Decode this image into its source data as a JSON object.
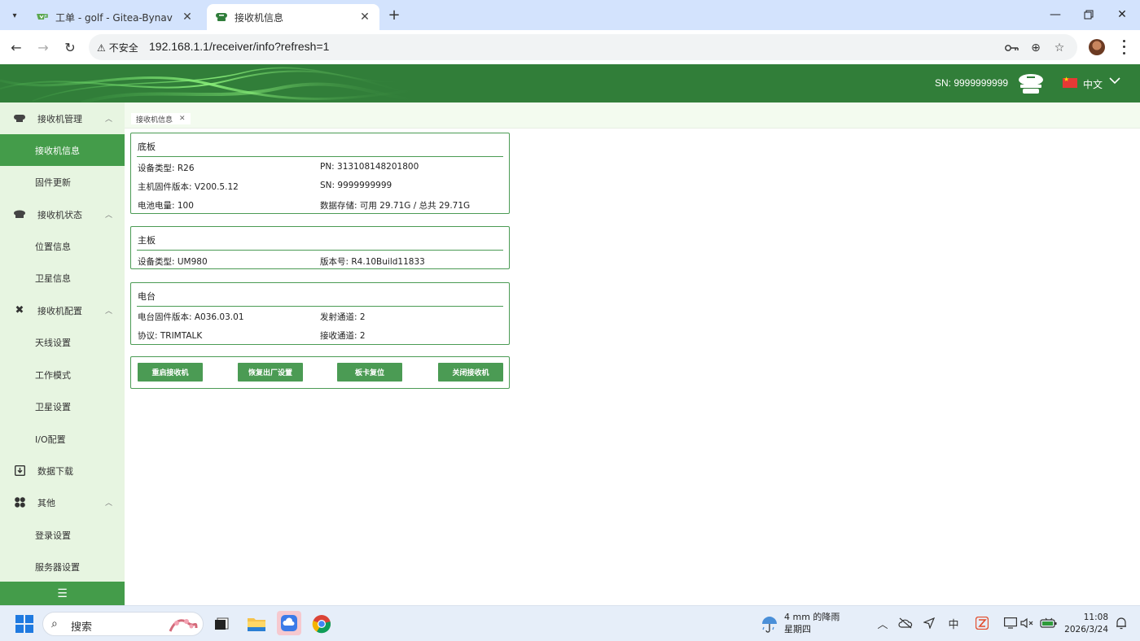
{
  "browser": {
    "tabs": [
      {
        "title": "工单 - golf - Gitea-Bynav",
        "active": false
      },
      {
        "title": "接收机信息",
        "active": true
      }
    ],
    "security_label": "不安全",
    "url": "192.168.1.1/receiver/info?refresh=1"
  },
  "header": {
    "sn": "SN: 9999999999",
    "language": "中文",
    "flag": "CN"
  },
  "sidebar": {
    "items": [
      {
        "label": "接收机管理",
        "type": "group",
        "icon": "receiver-manage-icon",
        "expanded": true
      },
      {
        "label": "接收机信息",
        "type": "sub",
        "active": true
      },
      {
        "label": "固件更新",
        "type": "sub"
      },
      {
        "label": "接收机状态",
        "type": "group",
        "icon": "receiver-status-icon",
        "expanded": true
      },
      {
        "label": "位置信息",
        "type": "sub"
      },
      {
        "label": "卫星信息",
        "type": "sub"
      },
      {
        "label": "接收机配置",
        "type": "group",
        "icon": "tools-icon",
        "expanded": true
      },
      {
        "label": "天线设置",
        "type": "sub"
      },
      {
        "label": "工作模式",
        "type": "sub"
      },
      {
        "label": "卫星设置",
        "type": "sub"
      },
      {
        "label": "I/O配置",
        "type": "sub"
      },
      {
        "label": "数据下载",
        "type": "group",
        "icon": "download-icon"
      },
      {
        "label": "其他",
        "type": "group",
        "icon": "grid-icon",
        "expanded": true
      },
      {
        "label": "登录设置",
        "type": "sub"
      },
      {
        "label": "服务器设置",
        "type": "sub"
      }
    ]
  },
  "page_tab": {
    "label": "接收机信息"
  },
  "baseboard": {
    "title": "底板",
    "device_type": "设备类型: R26",
    "pn": "PN: 313108148201800",
    "firmware": "主机固件版本: V200.5.12",
    "sn": "SN: 9999999999",
    "battery": "电池电量: 100",
    "storage": "数据存储: 可用 29.71G / 总共 29.71G"
  },
  "mainboard": {
    "title": "主板",
    "device_type": "设备类型: UM980",
    "version": "版本号: R4.10Build11833"
  },
  "radio": {
    "title": "电台",
    "firmware": "电台固件版本: A036.03.01",
    "tx_channel": "发射通道: 2",
    "protocol": "协议: TRIMTALK",
    "rx_channel": "接收通道: 2"
  },
  "actions": {
    "restart": "重启接收机",
    "factory_reset": "恢复出厂设置",
    "board_reset": "板卡复位",
    "shutdown": "关闭接收机"
  },
  "taskbar": {
    "search": "搜索",
    "weather_line1": "4 mm 的降雨",
    "weather_line2": "星期四",
    "ime": "中",
    "time": "11:08",
    "date": "2026/3/24"
  },
  "colors": {
    "header_green": "#317e39",
    "sidebar_bg": "#e7f5e1",
    "active_green": "#449c4a",
    "panel_border": "#4b9b54"
  }
}
